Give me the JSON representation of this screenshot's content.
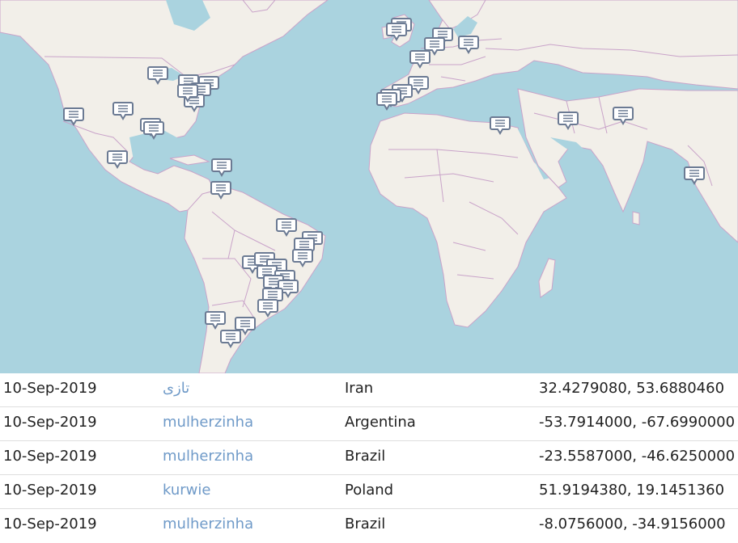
{
  "map": {
    "colors": {
      "water": "#aad3df",
      "land": "#f2efe9",
      "border": "#c9a3c9",
      "marker_fill": "#ffffff",
      "marker_stroke": "#6b7a93"
    },
    "marker_icon": "speech-bubble-icon"
  },
  "rows": [
    {
      "date": "10-Sep-2019",
      "word": "تازی",
      "country": "Iran",
      "coords": "32.4279080, 53.6880460"
    },
    {
      "date": "10-Sep-2019",
      "word": "mulherzinha",
      "country": "Argentina",
      "coords": "-53.7914000, -67.6990000"
    },
    {
      "date": "10-Sep-2019",
      "word": "mulherzinha",
      "country": "Brazil",
      "coords": "-23.5587000, -46.6250000"
    },
    {
      "date": "10-Sep-2019",
      "word": "kurwie",
      "country": "Poland",
      "coords": "51.9194380, 19.1451360"
    },
    {
      "date": "10-Sep-2019",
      "word": "mulherzinha",
      "country": "Brazil",
      "coords": "-8.0756000, -34.9156000"
    }
  ]
}
